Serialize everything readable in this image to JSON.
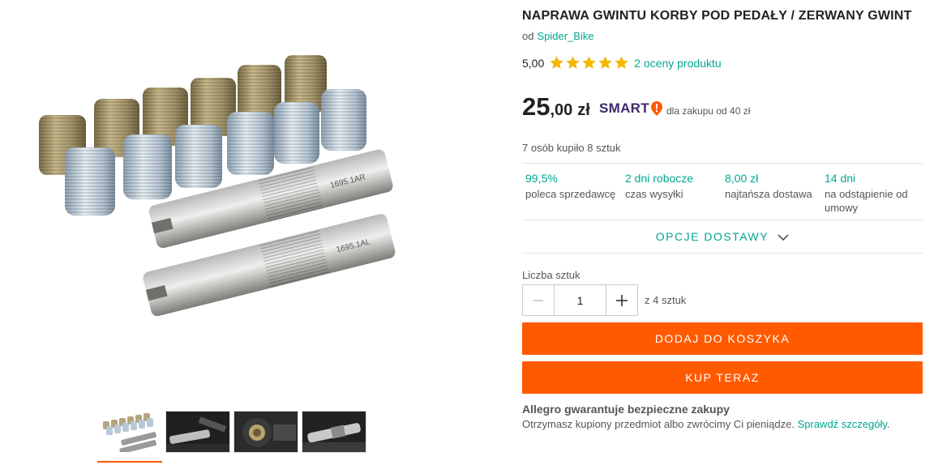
{
  "product": {
    "title": "NAPRAWA GWINTU KORBY POD PEDAŁY / ZERWANY GWINT",
    "seller_prefix": "od",
    "seller_name": "Spider_Bike"
  },
  "rating": {
    "score": "5,00",
    "stars": 5,
    "reviews_link": "2 oceny produktu"
  },
  "price": {
    "integer": "25",
    "decimal": ",00",
    "currency": "zł",
    "smart_label": "SMART",
    "smart_note": "dla zakupu od 40 zł"
  },
  "buyers_text": "7 osób kupiło 8 sztuk",
  "stats": [
    {
      "value": "99,5%",
      "label": "poleca sprzedawcę"
    },
    {
      "value": "2 dni robocze",
      "label": "czas wysyłki"
    },
    {
      "value": "8,00 zł",
      "label": "najtańsza dostawa"
    },
    {
      "value": "14 dni",
      "label": "na odstąpienie od umowy"
    }
  ],
  "delivery_options_label": "OPCJE DOSTAWY",
  "quantity": {
    "label": "Liczba sztuk",
    "value": "1",
    "of_text": "z 4 sztuk"
  },
  "buttons": {
    "add_to_cart": "DODAJ DO KOSZYKA",
    "buy_now": "KUP TERAZ"
  },
  "guarantee": {
    "title": "Allegro gwarantuje bezpieczne zakupy",
    "text": "Otrzymasz kupiony przedmiot albo zwrócimy Ci pieniądze.",
    "link": "Sprawdź szczegóły"
  },
  "colors": {
    "accent": "#ff5a00",
    "link": "#00a790",
    "star": "#f5b800",
    "smart": "#3d2a6b"
  },
  "gallery": {
    "thumbnails": 4,
    "active_index": 0
  }
}
